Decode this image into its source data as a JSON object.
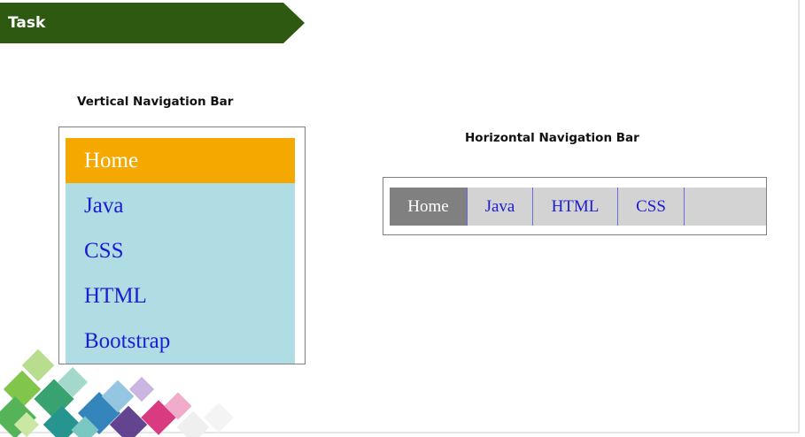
{
  "banner": {
    "title": "Task"
  },
  "vertical": {
    "heading": "Vertical Navigation Bar",
    "items": [
      {
        "label": "Home",
        "active": true
      },
      {
        "label": "Java"
      },
      {
        "label": "CSS"
      },
      {
        "label": "HTML"
      },
      {
        "label": "Bootstrap"
      }
    ],
    "colors": {
      "background": "#b0dce4",
      "active": "#f5a800",
      "text": "#1c1cd0"
    }
  },
  "horizontal": {
    "heading": "Horizontal Navigation Bar",
    "items": [
      {
        "label": "Home",
        "active": true
      },
      {
        "label": "Java"
      },
      {
        "label": "HTML"
      },
      {
        "label": "CSS"
      }
    ],
    "colors": {
      "background": "#d3d3d3",
      "active": "#808080",
      "text": "#1c1cd0"
    }
  },
  "theme": {
    "banner": "#2d5a10"
  }
}
